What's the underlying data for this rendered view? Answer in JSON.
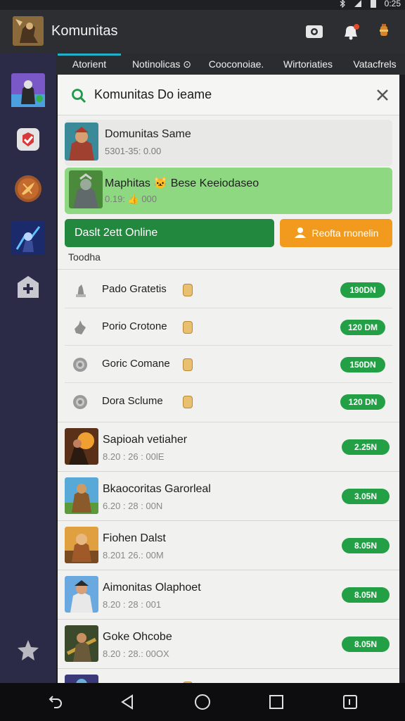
{
  "status_bar": {
    "time": "0:25"
  },
  "app_bar": {
    "title": "Komunitas"
  },
  "tabs": [
    {
      "label": "Atorient"
    },
    {
      "label": "Notinolicas ⊙"
    },
    {
      "label": "Cooconoiae."
    },
    {
      "label": "Wirtoriaties"
    },
    {
      "label": "Vatacfrels"
    }
  ],
  "search": {
    "value": "Komunitas Do ieame"
  },
  "featured": [
    {
      "title": "Domunitas Same",
      "subtitle": "5301-35: 0.00"
    },
    {
      "title": "Maphitas 🐱 Bese Keeiodaseo",
      "subtitle": "0.19: 👍 000"
    }
  ],
  "buttons": {
    "primary": "Daslt 2ett Online",
    "secondary": "Reofta rnonelin"
  },
  "section_label": "Toodha",
  "settings": [
    {
      "label": "Pado Gratetis",
      "value": "190DN",
      "icon": "puppet-icon"
    },
    {
      "label": "Porio Crotone",
      "value": "120 DM",
      "icon": "hand-icon"
    },
    {
      "label": "Goric Comane",
      "value": "150DN",
      "icon": "gear-icon"
    },
    {
      "label": "Dora Sclume",
      "value": "120 DN",
      "icon": "gear-icon"
    }
  ],
  "list": [
    {
      "title": "Sapioah vetiaher",
      "subtitle": "8.20 : 26 : 00lE",
      "value": "2.25N"
    },
    {
      "title": "Bkaocoritas Garorleal",
      "subtitle": "6.20 : 28 : 00N",
      "value": "3.05N"
    },
    {
      "title": "Fiohen Dalst",
      "subtitle": "8.201 26.: 00M",
      "value": "8.05N"
    },
    {
      "title": "Aimonitas Olaphoet",
      "subtitle": "8.20 : 28 : 001",
      "value": "8.05N"
    },
    {
      "title": "Goke Ohcobe",
      "subtitle": "8.20 : 28.: 00OX",
      "value": "8.05N"
    }
  ],
  "colors": {
    "accent": "#22b0c8",
    "green": "#22883e",
    "orange": "#f29a1e",
    "sidebar": "#2b2a47"
  }
}
